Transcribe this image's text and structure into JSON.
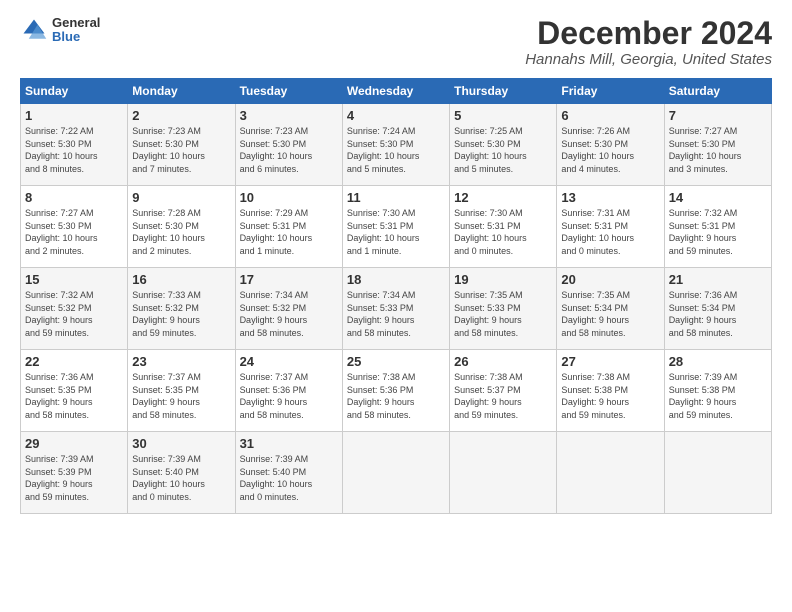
{
  "logo": {
    "general": "General",
    "blue": "Blue"
  },
  "title": "December 2024",
  "location": "Hannahs Mill, Georgia, United States",
  "headers": [
    "Sunday",
    "Monday",
    "Tuesday",
    "Wednesday",
    "Thursday",
    "Friday",
    "Saturday"
  ],
  "weeks": [
    [
      {
        "day": "1",
        "lines": [
          "Sunrise: 7:22 AM",
          "Sunset: 5:30 PM",
          "Daylight: 10 hours",
          "and 8 minutes."
        ]
      },
      {
        "day": "2",
        "lines": [
          "Sunrise: 7:23 AM",
          "Sunset: 5:30 PM",
          "Daylight: 10 hours",
          "and 7 minutes."
        ]
      },
      {
        "day": "3",
        "lines": [
          "Sunrise: 7:23 AM",
          "Sunset: 5:30 PM",
          "Daylight: 10 hours",
          "and 6 minutes."
        ]
      },
      {
        "day": "4",
        "lines": [
          "Sunrise: 7:24 AM",
          "Sunset: 5:30 PM",
          "Daylight: 10 hours",
          "and 5 minutes."
        ]
      },
      {
        "day": "5",
        "lines": [
          "Sunrise: 7:25 AM",
          "Sunset: 5:30 PM",
          "Daylight: 10 hours",
          "and 5 minutes."
        ]
      },
      {
        "day": "6",
        "lines": [
          "Sunrise: 7:26 AM",
          "Sunset: 5:30 PM",
          "Daylight: 10 hours",
          "and 4 minutes."
        ]
      },
      {
        "day": "7",
        "lines": [
          "Sunrise: 7:27 AM",
          "Sunset: 5:30 PM",
          "Daylight: 10 hours",
          "and 3 minutes."
        ]
      }
    ],
    [
      {
        "day": "8",
        "lines": [
          "Sunrise: 7:27 AM",
          "Sunset: 5:30 PM",
          "Daylight: 10 hours",
          "and 2 minutes."
        ]
      },
      {
        "day": "9",
        "lines": [
          "Sunrise: 7:28 AM",
          "Sunset: 5:30 PM",
          "Daylight: 10 hours",
          "and 2 minutes."
        ]
      },
      {
        "day": "10",
        "lines": [
          "Sunrise: 7:29 AM",
          "Sunset: 5:31 PM",
          "Daylight: 10 hours",
          "and 1 minute."
        ]
      },
      {
        "day": "11",
        "lines": [
          "Sunrise: 7:30 AM",
          "Sunset: 5:31 PM",
          "Daylight: 10 hours",
          "and 1 minute."
        ]
      },
      {
        "day": "12",
        "lines": [
          "Sunrise: 7:30 AM",
          "Sunset: 5:31 PM",
          "Daylight: 10 hours",
          "and 0 minutes."
        ]
      },
      {
        "day": "13",
        "lines": [
          "Sunrise: 7:31 AM",
          "Sunset: 5:31 PM",
          "Daylight: 10 hours",
          "and 0 minutes."
        ]
      },
      {
        "day": "14",
        "lines": [
          "Sunrise: 7:32 AM",
          "Sunset: 5:31 PM",
          "Daylight: 9 hours",
          "and 59 minutes."
        ]
      }
    ],
    [
      {
        "day": "15",
        "lines": [
          "Sunrise: 7:32 AM",
          "Sunset: 5:32 PM",
          "Daylight: 9 hours",
          "and 59 minutes."
        ]
      },
      {
        "day": "16",
        "lines": [
          "Sunrise: 7:33 AM",
          "Sunset: 5:32 PM",
          "Daylight: 9 hours",
          "and 59 minutes."
        ]
      },
      {
        "day": "17",
        "lines": [
          "Sunrise: 7:34 AM",
          "Sunset: 5:32 PM",
          "Daylight: 9 hours",
          "and 58 minutes."
        ]
      },
      {
        "day": "18",
        "lines": [
          "Sunrise: 7:34 AM",
          "Sunset: 5:33 PM",
          "Daylight: 9 hours",
          "and 58 minutes."
        ]
      },
      {
        "day": "19",
        "lines": [
          "Sunrise: 7:35 AM",
          "Sunset: 5:33 PM",
          "Daylight: 9 hours",
          "and 58 minutes."
        ]
      },
      {
        "day": "20",
        "lines": [
          "Sunrise: 7:35 AM",
          "Sunset: 5:34 PM",
          "Daylight: 9 hours",
          "and 58 minutes."
        ]
      },
      {
        "day": "21",
        "lines": [
          "Sunrise: 7:36 AM",
          "Sunset: 5:34 PM",
          "Daylight: 9 hours",
          "and 58 minutes."
        ]
      }
    ],
    [
      {
        "day": "22",
        "lines": [
          "Sunrise: 7:36 AM",
          "Sunset: 5:35 PM",
          "Daylight: 9 hours",
          "and 58 minutes."
        ]
      },
      {
        "day": "23",
        "lines": [
          "Sunrise: 7:37 AM",
          "Sunset: 5:35 PM",
          "Daylight: 9 hours",
          "and 58 minutes."
        ]
      },
      {
        "day": "24",
        "lines": [
          "Sunrise: 7:37 AM",
          "Sunset: 5:36 PM",
          "Daylight: 9 hours",
          "and 58 minutes."
        ]
      },
      {
        "day": "25",
        "lines": [
          "Sunrise: 7:38 AM",
          "Sunset: 5:36 PM",
          "Daylight: 9 hours",
          "and 58 minutes."
        ]
      },
      {
        "day": "26",
        "lines": [
          "Sunrise: 7:38 AM",
          "Sunset: 5:37 PM",
          "Daylight: 9 hours",
          "and 59 minutes."
        ]
      },
      {
        "day": "27",
        "lines": [
          "Sunrise: 7:38 AM",
          "Sunset: 5:38 PM",
          "Daylight: 9 hours",
          "and 59 minutes."
        ]
      },
      {
        "day": "28",
        "lines": [
          "Sunrise: 7:39 AM",
          "Sunset: 5:38 PM",
          "Daylight: 9 hours",
          "and 59 minutes."
        ]
      }
    ],
    [
      {
        "day": "29",
        "lines": [
          "Sunrise: 7:39 AM",
          "Sunset: 5:39 PM",
          "Daylight: 9 hours",
          "and 59 minutes."
        ]
      },
      {
        "day": "30",
        "lines": [
          "Sunrise: 7:39 AM",
          "Sunset: 5:40 PM",
          "Daylight: 10 hours",
          "and 0 minutes."
        ]
      },
      {
        "day": "31",
        "lines": [
          "Sunrise: 7:39 AM",
          "Sunset: 5:40 PM",
          "Daylight: 10 hours",
          "and 0 minutes."
        ]
      },
      null,
      null,
      null,
      null
    ]
  ]
}
